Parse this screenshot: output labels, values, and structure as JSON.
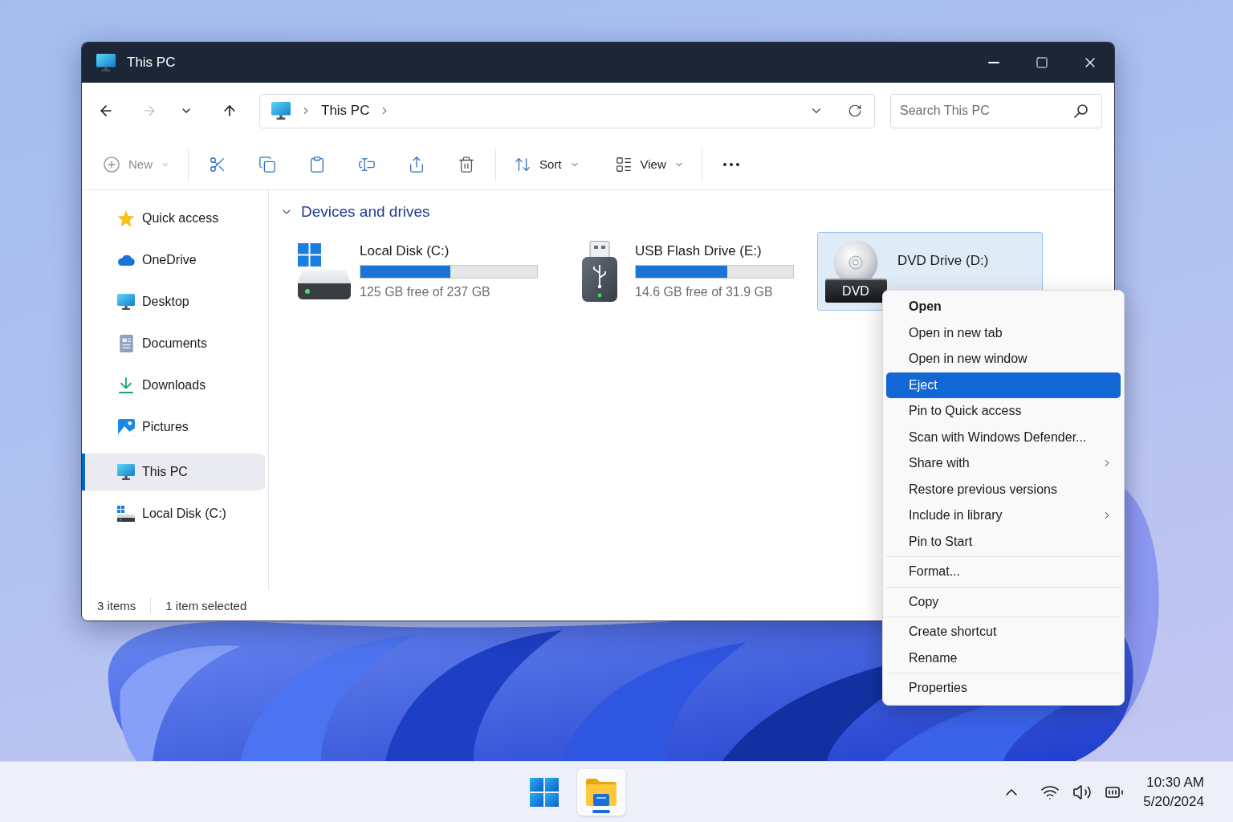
{
  "window": {
    "title": "This PC"
  },
  "nav_buttons": [
    {
      "kind": "back",
      "disabled": false
    },
    {
      "kind": "forward",
      "disabled": true
    },
    {
      "kind": "recent",
      "disabled": false
    },
    {
      "kind": "up",
      "disabled": false
    }
  ],
  "address_bar": {
    "crumbs": [
      "This PC"
    ]
  },
  "search": {
    "placeholder": "Search This PC"
  },
  "command_bar": {
    "groups": [
      {
        "items": [
          {
            "kind": "new",
            "label": "New",
            "disabled": true,
            "dropdown": true
          }
        ]
      },
      {
        "items": [
          {
            "kind": "cut",
            "disabled": false,
            "dropdown": false
          },
          {
            "kind": "copy",
            "disabled": false,
            "dropdown": false
          },
          {
            "kind": "paste",
            "disabled": false,
            "dropdown": false
          },
          {
            "kind": "rename",
            "disabled": false,
            "dropdown": false
          },
          {
            "kind": "share",
            "disabled": false,
            "dropdown": false
          },
          {
            "kind": "delete",
            "disabled": false,
            "dropdown": false
          }
        ]
      },
      {
        "items": [
          {
            "kind": "sort",
            "label": "Sort",
            "disabled": false,
            "dropdown": true
          },
          {
            "kind": "view",
            "label": "View",
            "disabled": false,
            "dropdown": true
          }
        ]
      },
      {
        "items": [
          {
            "kind": "more",
            "disabled": false,
            "dropdown": false
          }
        ]
      }
    ]
  },
  "sidebar": {
    "groups": [
      {
        "items": [
          {
            "kind": "quick_access",
            "label": "Quick access",
            "selected": false
          },
          {
            "kind": "onedrive",
            "label": "OneDrive",
            "selected": false
          },
          {
            "kind": "desktop",
            "label": "Desktop",
            "selected": false
          },
          {
            "kind": "documents",
            "label": "Documents",
            "selected": false
          },
          {
            "kind": "downloads",
            "label": "Downloads",
            "selected": false
          },
          {
            "kind": "pictures",
            "label": "Pictures",
            "selected": false
          }
        ]
      },
      {
        "items": [
          {
            "kind": "this_pc",
            "label": "This PC",
            "selected": true
          },
          {
            "kind": "local_disk",
            "label": "Local Disk (C:)",
            "selected": false
          }
        ]
      }
    ]
  },
  "content": {
    "section": {
      "title": "Devices and drives",
      "expanded": true
    },
    "drives": [
      {
        "kind": "local_disk",
        "name": "Local Disk (C:)",
        "level": 0.51,
        "space": "125 GB free of 237 GB",
        "selected": false
      },
      {
        "kind": "usb",
        "name": "USB Flash Drive (E:)",
        "level": 0.58,
        "space": "14.6 GB free of 31.9 GB",
        "selected": false
      },
      {
        "kind": "dvd",
        "name": "DVD Drive (D:)",
        "disc_label": "DVD",
        "selected": true
      }
    ]
  },
  "status_bar": {
    "item_count": "3 items",
    "selection": "1 item selected"
  },
  "context_menu": {
    "groups": [
      {
        "items": [
          {
            "kind": "default",
            "label": "Open",
            "selected": false
          },
          {
            "kind": "normal",
            "label": "Open in new tab",
            "selected": false
          },
          {
            "kind": "normal",
            "label": "Open in new window",
            "selected": false
          },
          {
            "kind": "normal",
            "label": "Eject",
            "selected": true
          },
          {
            "kind": "normal",
            "label": "Pin to Quick access",
            "selected": false
          },
          {
            "kind": "normal",
            "label": "Scan with Windows Defender...",
            "selected": false
          },
          {
            "kind": "submenu",
            "label": "Share with",
            "selected": false
          },
          {
            "kind": "normal",
            "label": "Restore previous versions",
            "selected": false
          },
          {
            "kind": "submenu",
            "label": "Include in library",
            "selected": false
          },
          {
            "kind": "normal",
            "label": "Pin to Start",
            "selected": false
          }
        ]
      },
      {
        "items": [
          {
            "kind": "normal",
            "label": "Format...",
            "selected": false
          }
        ]
      },
      {
        "items": [
          {
            "kind": "normal",
            "label": "Copy",
            "selected": false
          }
        ]
      },
      {
        "items": [
          {
            "kind": "normal",
            "label": "Create shortcut",
            "selected": false
          },
          {
            "kind": "normal",
            "label": "Rename",
            "selected": false
          }
        ]
      },
      {
        "items": [
          {
            "kind": "normal",
            "label": "Properties",
            "selected": false
          }
        ]
      }
    ]
  },
  "taskbar": {
    "apps": [
      {
        "kind": "start",
        "selected": false
      },
      {
        "kind": "file_explorer",
        "selected": true
      }
    ],
    "clock": {
      "time": "10:30 AM",
      "date": "5/20/2024"
    }
  }
}
